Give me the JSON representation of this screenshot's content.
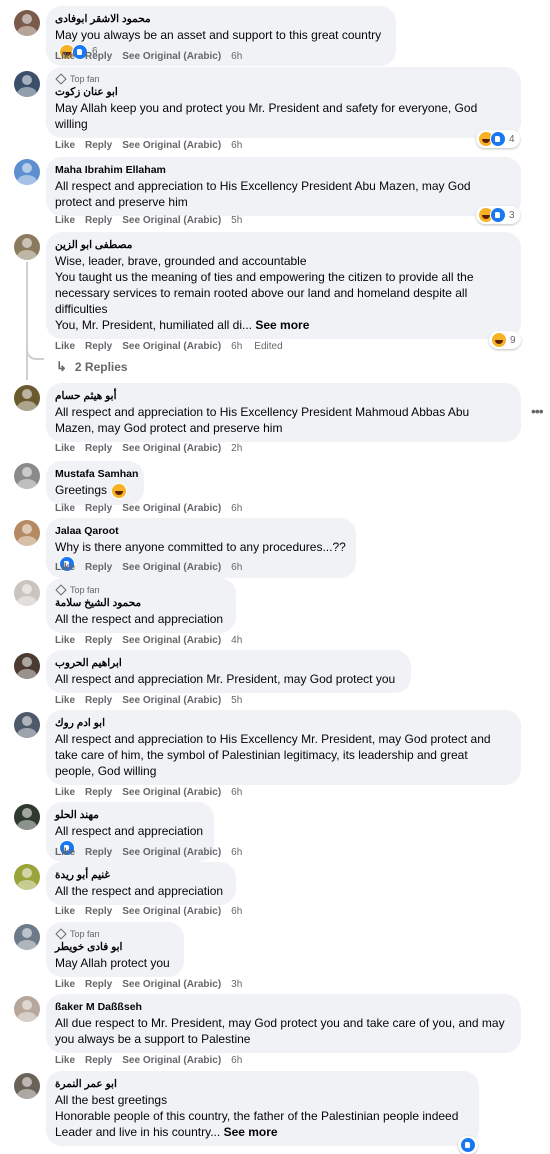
{
  "actions": {
    "like": "Like",
    "reply": "Reply",
    "see_original": "See Original (Arabic)"
  },
  "see_more": "See more",
  "top_fan_label": "Top fan",
  "more_options_icon": "more-options-icon",
  "comments": [
    {
      "author": "محمود الاشقر ابوفادى",
      "top_fan": false,
      "lines": [
        "May you always be an asset and support to this great country"
      ],
      "inline_reactions": [
        "haha",
        "like"
      ],
      "inline_count": "6",
      "time": "6h"
    },
    {
      "author": "ابو عنان زكوت",
      "top_fan": true,
      "lines": [
        "May Allah keep you and protect you Mr. President and safety for everyone, God",
        "willing"
      ],
      "reactions": [
        "haha",
        "like"
      ],
      "reaction_count": "4",
      "time": "6h"
    },
    {
      "author": "Maha Ibrahim Ellaham",
      "top_fan": false,
      "lines": [
        "All respect and appreciation to His Excellency President Abu Mazen, may God",
        "protect and preserve him"
      ],
      "reactions": [
        "haha",
        "like"
      ],
      "reaction_count": "3",
      "time": "5h"
    },
    {
      "author": "مصطفى ابو الزين",
      "top_fan": false,
      "lines": [
        "Wise, leader, brave, grounded and accountable",
        "You taught us the meaning of ties and empowering the citizen to provide all the",
        "necessary services to remain rooted above our land and homeland despite all",
        "difficulties",
        "You, Mr. President, humiliated all di..."
      ],
      "see_more_last": true,
      "reactions": [
        "haha"
      ],
      "reaction_count": "9",
      "time": "6h",
      "edited": "Edited",
      "replies": "2 Replies"
    },
    {
      "author": "أبو هيثم حسام",
      "top_fan": false,
      "lines": [
        "All respect and appreciation to His Excellency President Mahmoud Abbas Abu",
        "Mazen, may God protect and preserve him"
      ],
      "time": "2h"
    },
    {
      "author": "Mustafa Samhan",
      "top_fan": false,
      "lines": [
        "Greetings"
      ],
      "side_reactions": [
        "haha"
      ],
      "time": "6h"
    },
    {
      "author": "Jalaa Qaroot",
      "top_fan": false,
      "lines": [
        "Why is there anyone committed to any procedures...??"
      ],
      "side_reactions": [
        "like"
      ],
      "time": "6h"
    },
    {
      "author": "محمود الشيخ سلامة",
      "top_fan": true,
      "lines": [
        "All the respect and appreciation"
      ],
      "time": "4h"
    },
    {
      "author": "ابراهيم الحروب",
      "top_fan": false,
      "lines": [
        "All respect and appreciation Mr. President, may God protect you"
      ],
      "time": "5h"
    },
    {
      "author": "ابو ادم روك",
      "top_fan": false,
      "lines": [
        "All respect and appreciation to His Excellency Mr. President, may God protect and",
        "take care of him, the symbol of Palestinian legitimacy, its leadership and great",
        "people, God willing"
      ],
      "time": "6h"
    },
    {
      "author": "مهند الحلو",
      "top_fan": false,
      "lines": [
        "All respect and appreciation"
      ],
      "side_reactions": [
        "like"
      ],
      "time": "6h"
    },
    {
      "author": "غنيم أبو ريدة",
      "top_fan": false,
      "lines": [
        "All the respect and appreciation"
      ],
      "time": "6h"
    },
    {
      "author": "ابو فادى خويطر",
      "top_fan": true,
      "lines": [
        "May Allah protect you"
      ],
      "time": "3h"
    },
    {
      "author": "ßaker M Daßßseh",
      "top_fan": false,
      "lines": [
        "All due respect to Mr. President, may God protect you and take care of you, and may",
        "you always be a support to Palestine"
      ],
      "time": "6h"
    },
    {
      "author": "ابو عمر النمرة",
      "top_fan": false,
      "lines": [
        "All the best greetings",
        "Honorable people of this country, the father of the Palestinian people indeed",
        "Leader and live in his country..."
      ],
      "see_more_last": true,
      "reactions": [
        "like"
      ],
      "reaction_count": ""
    }
  ]
}
